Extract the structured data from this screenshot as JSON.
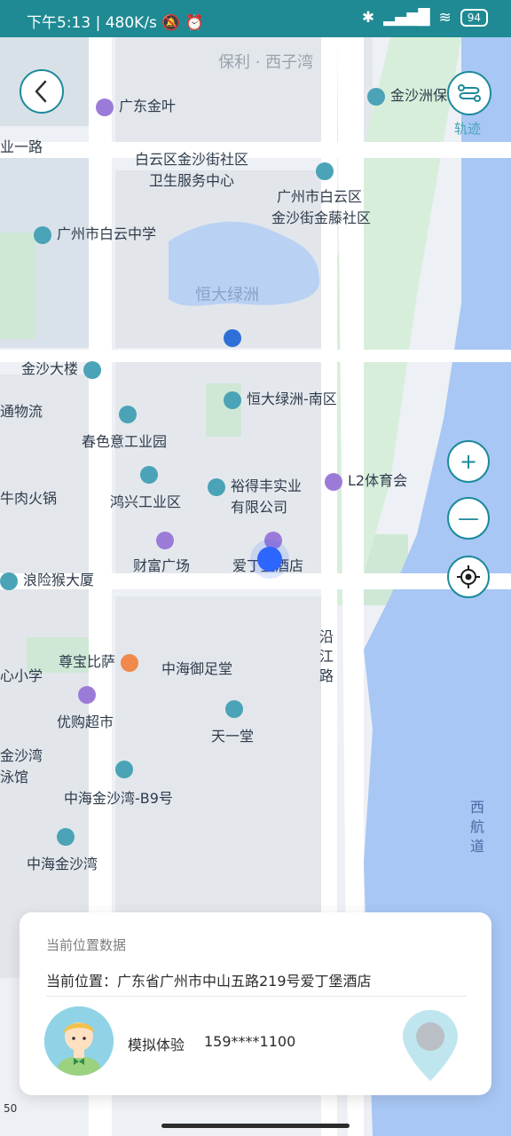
{
  "status_bar": {
    "time": "下午5:13",
    "speed": "480K/s",
    "battery": "94"
  },
  "map": {
    "labels": [
      {
        "key": "l1",
        "text": "保利 · 西子湾",
        "icon": "none"
      },
      {
        "key": "l2",
        "text": "金沙洲保利",
        "icon": "teal"
      },
      {
        "key": "l3",
        "text": "广东金叶",
        "icon": "purple"
      },
      {
        "key": "l4",
        "text": "业一路",
        "icon": "none"
      },
      {
        "key": "l5",
        "text": "白云区金沙街社区",
        "icon": "none"
      },
      {
        "key": "l6",
        "text": "卫生服务中心",
        "icon": "none"
      },
      {
        "key": "l7",
        "text": "广州市白云区",
        "icon": "teal"
      },
      {
        "key": "l8",
        "text": "金沙街金藤社区",
        "icon": "none"
      },
      {
        "key": "l9",
        "text": "广州市白云中学",
        "icon": "teal"
      },
      {
        "key": "l10",
        "text": "恒大绿洲",
        "icon": "none"
      },
      {
        "key": "l11",
        "text": "金沙大楼",
        "icon": "teal"
      },
      {
        "key": "l12",
        "text": "恒大绿洲-南区",
        "icon": "teal"
      },
      {
        "key": "l13",
        "text": "通物流",
        "icon": "none"
      },
      {
        "key": "l14",
        "text": "春色意工业园",
        "icon": "teal"
      },
      {
        "key": "l15",
        "text": "裕得丰实业",
        "icon": "teal"
      },
      {
        "key": "l16",
        "text": "有限公司",
        "icon": "none"
      },
      {
        "key": "l17",
        "text": "L2体育会",
        "icon": "purple"
      },
      {
        "key": "l18",
        "text": "鸿兴工业区",
        "icon": "teal"
      },
      {
        "key": "l19",
        "text": "牛肉火锅",
        "icon": "none"
      },
      {
        "key": "l20",
        "text": "财富广场",
        "icon": "purple"
      },
      {
        "key": "l21",
        "text": "爱丁堡酒店",
        "icon": "purple"
      },
      {
        "key": "l22",
        "text": "浪险猴大厦",
        "icon": "teal"
      },
      {
        "key": "l23",
        "text": "沿",
        "icon": "none"
      },
      {
        "key": "l24",
        "text": "江",
        "icon": "none"
      },
      {
        "key": "l25",
        "text": "路",
        "icon": "none"
      },
      {
        "key": "l26",
        "text": "尊宝比萨",
        "icon": "orange"
      },
      {
        "key": "l27",
        "text": "中海御足堂",
        "icon": "none"
      },
      {
        "key": "l28",
        "text": "心小学",
        "icon": "none"
      },
      {
        "key": "l29",
        "text": "优购超市",
        "icon": "purple"
      },
      {
        "key": "l30",
        "text": "天一堂",
        "icon": "teal"
      },
      {
        "key": "l31",
        "text": "金沙湾",
        "icon": "none"
      },
      {
        "key": "l32",
        "text": "泳馆",
        "icon": "none"
      },
      {
        "key": "l33",
        "text": "中海金沙湾-B9号",
        "icon": "teal"
      },
      {
        "key": "l34",
        "text": "中海金沙湾",
        "icon": "teal"
      },
      {
        "key": "l35",
        "text": "西",
        "icon": "none"
      },
      {
        "key": "l36",
        "text": "航",
        "icon": "none"
      },
      {
        "key": "l37",
        "text": "道",
        "icon": "none"
      }
    ],
    "scale": "50"
  },
  "buttons": {
    "track_label": "轨迹",
    "zoom_in": "+",
    "zoom_out": "—"
  },
  "card": {
    "title": "当前位置数据",
    "location": "当前位置：广东省广州市中山五路219号爱丁堡酒店",
    "name": "模拟体验",
    "phone": "159****1100"
  }
}
